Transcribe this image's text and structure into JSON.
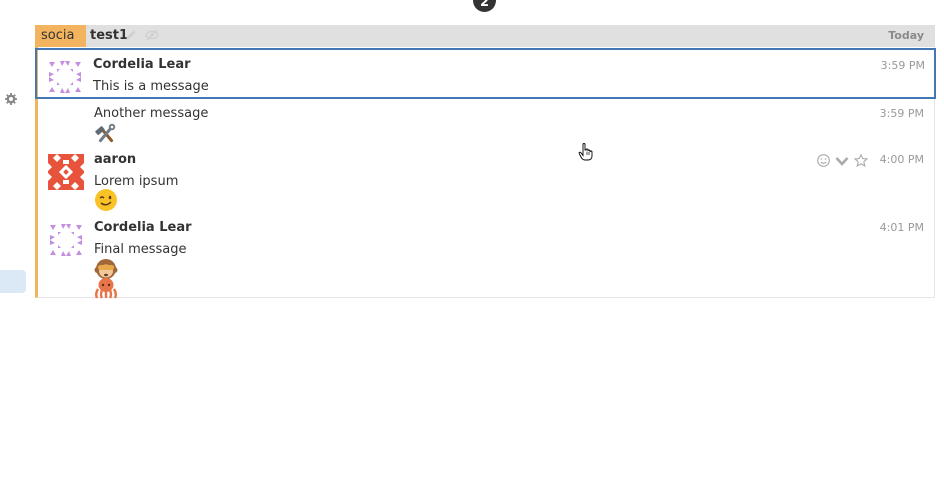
{
  "notification": {
    "count": "2"
  },
  "recipient": {
    "stream": "social",
    "topic": "test1",
    "date": "Today"
  },
  "messages": [
    {
      "sender": "Cordelia Lear",
      "content": "This is a message",
      "time": "3:59 PM",
      "selected": true
    },
    {
      "sender": "",
      "content": "Another message",
      "time": "3:59 PM",
      "emoji": "hammer-and-wrench"
    },
    {
      "sender": "aaron",
      "content": "Lorem ipsum",
      "time": "4:00 PM",
      "emoji": "winking-face"
    },
    {
      "sender": "Cordelia Lear",
      "content": "Final message",
      "time": "4:01 PM",
      "emoji": [
        "monkey",
        "octopus"
      ]
    }
  ],
  "colors": {
    "stream": "#f2b45f",
    "selected_border": "#4576b6",
    "avatar_cordelia": "#c58fe0",
    "avatar_aaron": "#e8533b"
  },
  "icons": {
    "settings": "gear-icon",
    "topic_edit": "pencil-icon",
    "topic_mute": "eye-slash-icon",
    "reaction": "smiley-icon",
    "actions": "chevron-down-icon",
    "star": "star-icon"
  }
}
